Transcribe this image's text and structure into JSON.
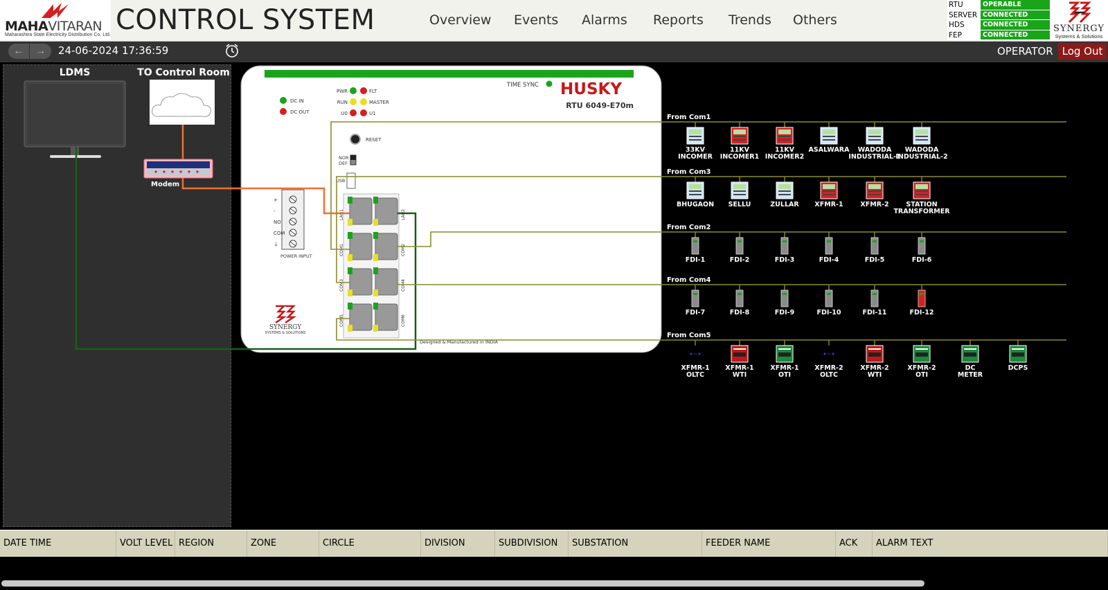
{
  "header": {
    "brand_bold": "MAHA",
    "brand_light": "VITARAN",
    "brand_sub": "Maharashtra State Electricity Distribution Co. Ltd.",
    "title": "CONTROL SYSTEM",
    "nav": [
      "Overview",
      "Events",
      "Alarms",
      "Reports",
      "Trends",
      "Others"
    ],
    "status": [
      {
        "label": "RTU",
        "value": "OPERABLE"
      },
      {
        "label": "SERVER",
        "value": "CONNECTED"
      },
      {
        "label": "HDS",
        "value": "CONNECTED"
      },
      {
        "label": "FEP",
        "value": "CONNECTED"
      }
    ],
    "right_logo_line1": "SYNERGY",
    "right_logo_line2": "Systems & Solutions"
  },
  "toolbar": {
    "datetime": "24-06-2024 17:36:59",
    "role": "OPERATOR",
    "logout": "Log Out"
  },
  "left_panel": {
    "ldms_label": "LDMS",
    "control_room_label": "TO Control Room",
    "modem_label": "Modem"
  },
  "rtu": {
    "brand": "HUSKY",
    "model": "RTU 6049-E70m",
    "time_sync": "TIME SYNC",
    "dc_in": "DC IN",
    "dc_out": "DC OUT",
    "pwr": "PWR",
    "flt": "FLT",
    "run": "RUN",
    "master": "MASTER",
    "u0": "U0",
    "u1": "U1",
    "reset": "RESET",
    "nor": "NOR",
    "def": "DEF",
    "usb": "USB",
    "power_input": "POWER INPUT",
    "terminals": [
      "+",
      "-",
      "NO",
      "COM",
      "⏚"
    ],
    "ports": [
      "LAN1",
      "LAN2",
      "COM1",
      "COM2",
      "COM3",
      "COM4",
      "COM5",
      "COM6"
    ],
    "synergy": "SYNERGY",
    "synergy_sub": "SYSTEMS & SOLUTIONS",
    "made_in": "Designed & Manufactured in INDIA"
  },
  "buses": [
    {
      "label": "From Com1",
      "devices": [
        {
          "name": [
            "33KV",
            "INCOMER"
          ],
          "type": "meter",
          "color": "#cfe6f5"
        },
        {
          "name": [
            "11KV",
            "INCOMER1"
          ],
          "type": "meter",
          "color": "#d62020"
        },
        {
          "name": [
            "11KV",
            "INCOMER2"
          ],
          "type": "meter",
          "color": "#d62020"
        },
        {
          "name": [
            "ASALWARA"
          ],
          "type": "meter",
          "color": "#cfe6f5"
        },
        {
          "name": [
            "WADODA",
            "INDUSTRIAL-1"
          ],
          "type": "meter",
          "color": "#cfe6f5"
        },
        {
          "name": [
            "WADODA",
            "INDUSTRIAL-2"
          ],
          "type": "meter",
          "color": "#cfe6f5"
        }
      ]
    },
    {
      "label": "From Com3",
      "devices": [
        {
          "name": [
            "BHUGAON"
          ],
          "type": "meter",
          "color": "#cfe6f5"
        },
        {
          "name": [
            "SELLU"
          ],
          "type": "meter",
          "color": "#cfe6f5"
        },
        {
          "name": [
            "ZULLAR"
          ],
          "type": "meter",
          "color": "#cfe6f5"
        },
        {
          "name": [
            "XFMR-1"
          ],
          "type": "meter",
          "color": "#d62020"
        },
        {
          "name": [
            "XFMR-2"
          ],
          "type": "meter",
          "color": "#d62020"
        },
        {
          "name": [
            "STATION",
            "TRANSFORMER"
          ],
          "type": "meter",
          "color": "#d62020"
        }
      ]
    },
    {
      "label": "From Com2",
      "devices": [
        {
          "name": [
            "FDI-1"
          ],
          "type": "fdi",
          "color": "#8a8a8a"
        },
        {
          "name": [
            "FDI-2"
          ],
          "type": "fdi",
          "color": "#8a8a8a"
        },
        {
          "name": [
            "FDI-3"
          ],
          "type": "fdi",
          "color": "#8a8a8a"
        },
        {
          "name": [
            "FDI-4"
          ],
          "type": "fdi",
          "color": "#8a8a8a"
        },
        {
          "name": [
            "FDI-5"
          ],
          "type": "fdi",
          "color": "#8a8a8a"
        },
        {
          "name": [
            "FDI-6"
          ],
          "type": "fdi",
          "color": "#8a8a8a"
        }
      ]
    },
    {
      "label": "From Com4",
      "devices": [
        {
          "name": [
            "FDI-7"
          ],
          "type": "fdi",
          "color": "#8a8a8a"
        },
        {
          "name": [
            "FDI-8"
          ],
          "type": "fdi",
          "color": "#8a8a8a"
        },
        {
          "name": [
            "FDI-9"
          ],
          "type": "fdi",
          "color": "#8a8a8a"
        },
        {
          "name": [
            "FDI-10"
          ],
          "type": "fdi",
          "color": "#8a8a8a"
        },
        {
          "name": [
            "FDI-11"
          ],
          "type": "fdi",
          "color": "#8a8a8a"
        },
        {
          "name": [
            "FDI-12"
          ],
          "type": "fdi",
          "color": "#d62020"
        }
      ]
    },
    {
      "label": "From Com5",
      "devices": [
        {
          "name": [
            "XFMR-1",
            "OLTC"
          ],
          "type": "oltc",
          "color": "#1a3bd6"
        },
        {
          "name": [
            "XFMR-1",
            "WTI"
          ],
          "type": "panel",
          "color": "#c01818"
        },
        {
          "name": [
            "XFMR-1",
            "OTI"
          ],
          "type": "panel",
          "color": "#1a8a3a"
        },
        {
          "name": [
            "XFMR-2",
            "OLTC"
          ],
          "type": "oltc",
          "color": "#1a3bd6"
        },
        {
          "name": [
            "XFMR-2",
            "WTI"
          ],
          "type": "panel",
          "color": "#c01818"
        },
        {
          "name": [
            "XFMR-2",
            "OTI"
          ],
          "type": "panel",
          "color": "#1a8a3a"
        },
        {
          "name": [
            "DC",
            "METER"
          ],
          "type": "panel",
          "color": "#1a8a3a"
        },
        {
          "name": [
            "DCPS"
          ],
          "type": "panel",
          "color": "#1a8a3a"
        }
      ]
    }
  ],
  "alarm_table": {
    "columns": [
      "DATE TIME",
      "VOLT LEVEL",
      "REGION",
      "ZONE",
      "CIRCLE",
      "DIVISION",
      "SUBDIVISION",
      "SUBSTATION",
      "FEEDER NAME",
      "ACK",
      "ALARM TEXT"
    ]
  },
  "colors": {
    "status_ok": "#1aa41a",
    "logout_bg": "#8b1a1a",
    "bus_line": "#8c8c2a",
    "fiber_green": "#1a5c1a",
    "modem_orange": "#f07030"
  }
}
